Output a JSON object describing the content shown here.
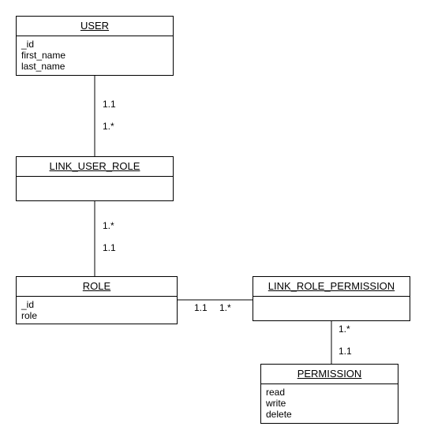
{
  "entities": {
    "user": {
      "title": "USER",
      "attrs": "_id\nfirst_name\nlast_name"
    },
    "link_user_role": {
      "title": "LINK_USER_ROLE",
      "attrs": ""
    },
    "role": {
      "title": "ROLE",
      "attrs": "_id\nrole"
    },
    "link_role_permission": {
      "title": "LINK_ROLE_PERMISSION",
      "attrs": ""
    },
    "permission": {
      "title": "PERMISSION",
      "attrs": "read\nwrite\ndelete"
    }
  },
  "mult": {
    "m1": "1.1",
    "m2": "1.*",
    "m3": "1.*",
    "m4": "1.1",
    "m5": "1.1",
    "m6": "1.*",
    "m7": "1.*",
    "m8": "1.1"
  }
}
